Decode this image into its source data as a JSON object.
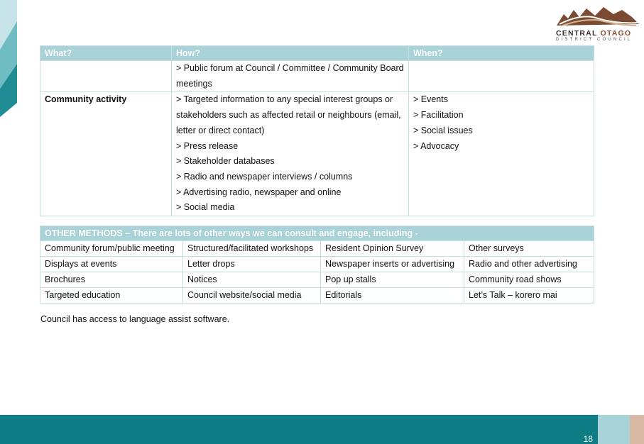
{
  "logo": {
    "line1a": "CENTRAL",
    "line1b": "OTAGO",
    "line2": "DISTRICT COUNCIL"
  },
  "table1": {
    "headers": [
      "What?",
      "How?",
      "When?"
    ],
    "rows": [
      {
        "what": "",
        "how": [
          "> Public forum at Council / Committee / Community Board meetings"
        ],
        "when": []
      },
      {
        "what": "Community activity",
        "how": [
          "> Targeted information to any special interest groups or stakeholders such as affected retail or neighbours (email, letter or direct contact)",
          "> Press release",
          "> Stakeholder databases",
          "> Radio and newspaper interviews / columns",
          "> Advertising radio, newspaper and online",
          "> Social media"
        ],
        "when": [
          "> Events",
          "> Facilitation",
          "> Social issues",
          "> Advocacy"
        ]
      }
    ]
  },
  "table2": {
    "header": "OTHER METHODS – There are lots of other ways we can consult and engage, including -",
    "rows": [
      [
        "Community forum/public meeting",
        "Structured/facilitated workshops",
        "Resident Opinion Survey",
        "Other surveys"
      ],
      [
        "Displays at events",
        "Letter drops",
        "Newspaper inserts or advertising",
        "Radio and other advertising"
      ],
      [
        "Brochures",
        "Notices",
        "Pop up stalls",
        "Community road shows"
      ],
      [
        "Targeted education",
        "Council website/social media",
        "Editorials",
        "Let’s Talk – korero mai"
      ]
    ]
  },
  "note": "Council has access to language assist software.",
  "page_number": "18",
  "colors": {
    "header_bg": "#a9d3d8",
    "footer_teal": "#0e7d84",
    "footer_light": "#a7d3d9",
    "footer_tan": "#d9b8a6"
  }
}
